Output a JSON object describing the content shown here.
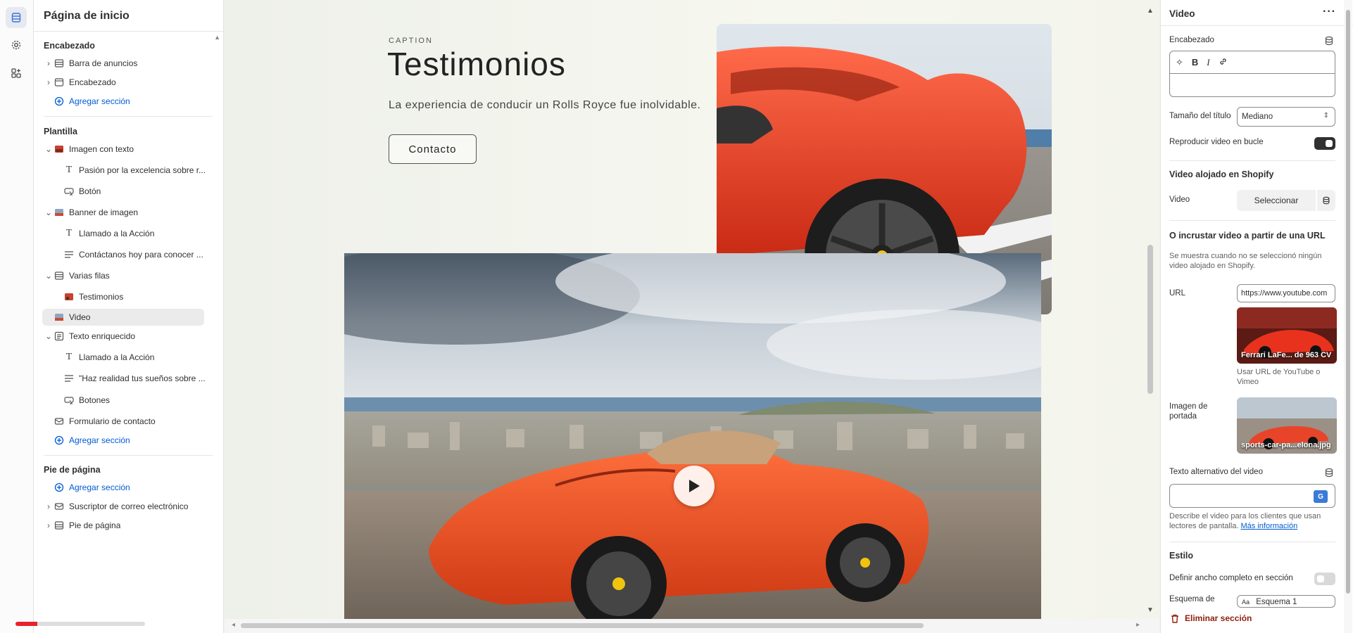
{
  "left_panel": {
    "title": "Página de inicio",
    "sections": {
      "header": {
        "title": "Encabezado",
        "items": [
          "Barra de anuncios",
          "Encabezado"
        ],
        "add": "Agregar sección"
      },
      "template": {
        "title": "Plantilla",
        "items": [
          "Imagen con texto",
          "Pasión por la excelencia sobre r...",
          "Botón",
          "Banner de imagen",
          "Llamado a la Acción",
          "Contáctanos hoy para conocer ...",
          "Varias filas",
          "Testimonios",
          "Video",
          "Texto enriquecido",
          "Llamado a la Acción",
          "\"Haz realidad tus sueños sobre ...",
          "Botones",
          "Formulario de contacto"
        ],
        "add": "Agregar sección"
      },
      "footer": {
        "title": "Pie de página",
        "add": "Agregar sección",
        "items": [
          "Suscriptor de correo electrónico",
          "Pie de página"
        ]
      }
    }
  },
  "canvas": {
    "caption": "CAPTION",
    "heading": "Testimonios",
    "subtitle": "La experiencia de conducir un Rolls Royce fue inolvidable.",
    "button": "Contacto"
  },
  "right_panel": {
    "title": "Video",
    "more": "···",
    "heading_label": "Encabezado",
    "rte": {
      "bold": "B",
      "italic": "I"
    },
    "title_size_label": "Tamaño del título",
    "title_size_value": "Mediano",
    "loop_label": "Reproducir video en bucle",
    "loop_on": true,
    "shopify_heading": "Video alojado en Shopify",
    "video_label": "Video",
    "select_button": "Seleccionar",
    "embed_heading": "O incrustar video a partir de una URL",
    "embed_help": "Se muestra cuando no se seleccionó ningún video alojado en Shopify.",
    "url_label": "URL",
    "url_value": "https://www.youtube.com",
    "url_thumb_caption": "Ferrari LaFe... de 963 CV",
    "url_help": "Usar URL de YouTube o Vimeo",
    "cover_label": "Imagen de portada",
    "cover_caption": "sports-car-pa...elona.jpg",
    "alt_label": "Texto alternativo del video",
    "alt_help": "Describe el video para los clientes que usan lectores de pantalla.",
    "alt_link": "Más información",
    "style_heading": "Estilo",
    "full_width_label": "Definir ancho completo en sección",
    "full_width_on": false,
    "scheme_label": "Esquema de",
    "scheme_value": "Esquema 1",
    "delete": "Eliminar sección"
  },
  "progress": {
    "played_fraction": 0.17
  },
  "colors": {
    "accent_link": "#005bd3",
    "car_red": "#e8442a",
    "delete_red": "#8e1f0b",
    "progress_red": "#e8222c"
  }
}
